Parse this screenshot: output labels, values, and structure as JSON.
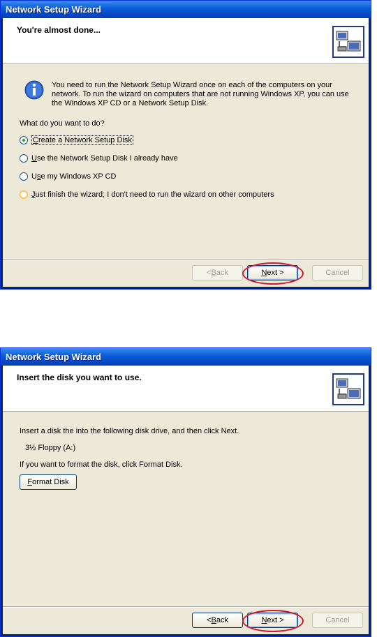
{
  "window1": {
    "title": "Network Setup Wizard",
    "header_title": "You're almost done...",
    "info_text": "You need to run the Network Setup Wizard once on each of the computers on your network. To run the wizard on computers that are not running Windows XP, you can use the Windows XP CD or a Network Setup Disk.",
    "question": "What do you want to do?",
    "options": [
      {
        "first": "C",
        "rest": "reate a Network Setup Disk",
        "selected": true
      },
      {
        "first": "U",
        "rest": "se the Network Setup Disk I already have",
        "selected": false
      },
      {
        "pre": "U",
        "first": "s",
        "rest": "e my Windows XP CD",
        "selected": false
      },
      {
        "first": "J",
        "rest": "ust finish the wizard; I don't need to run the wizard on other computers",
        "selected": false
      }
    ],
    "buttons": {
      "back": {
        "pre": "< ",
        "first": "B",
        "rest": "ack",
        "enabled": false
      },
      "next": {
        "first": "N",
        "rest": "ext >",
        "enabled": true
      },
      "cancel": {
        "label": "Cancel",
        "enabled": false
      }
    }
  },
  "window2": {
    "title": "Network Setup Wizard",
    "header_title": "Insert the disk you want to use.",
    "instruction": "Insert a disk the into the following disk drive, and then click Next.",
    "drive": "3½ Floppy (A:)",
    "format_hint": "If you want to format the disk, click Format Disk.",
    "format_button": {
      "first": "F",
      "rest": "ormat Disk"
    },
    "buttons": {
      "back": {
        "pre": "< ",
        "first": "B",
        "rest": "ack",
        "enabled": true
      },
      "next": {
        "first": "N",
        "rest": "ext >",
        "enabled": true
      },
      "cancel": {
        "label": "Cancel",
        "enabled": false
      }
    }
  },
  "colors": {
    "title_blue": "#0a5bd6",
    "dialog_bg": "#ece9d8",
    "annotation_red": "#d0182b"
  }
}
